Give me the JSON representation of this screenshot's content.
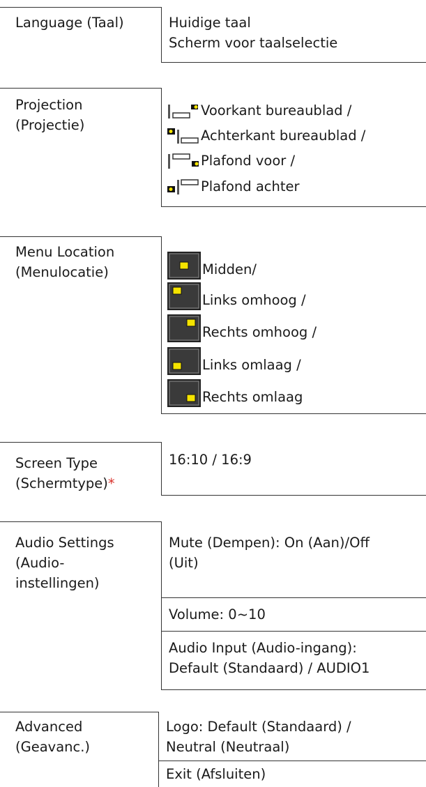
{
  "sections": [
    {
      "label_lines": [
        "Language (Taal)"
      ],
      "values": [
        [
          "Huidige taal",
          "Scherm voor taalselectie"
        ]
      ]
    },
    {
      "label_lines": [
        "Projection",
        "(Projectie)"
      ],
      "icon_items": [
        {
          "icon": "desk-front-projection-icon",
          "text": "Voorkant bureaublad /"
        },
        {
          "icon": "desk-rear-projection-icon",
          "text": "Achterkant bureaublad /"
        },
        {
          "icon": "ceiling-front-projection-icon",
          "text": "Plafond voor /"
        },
        {
          "icon": "ceiling-rear-projection-icon",
          "text": "Plafond achter"
        }
      ]
    },
    {
      "label_lines": [
        "Menu Location",
        "(Menulocatie)"
      ],
      "icon_items": [
        {
          "icon": "menu-center-icon",
          "text": "Midden/"
        },
        {
          "icon": "menu-top-left-icon",
          "text": "Links omhoog /"
        },
        {
          "icon": "menu-top-right-icon",
          "text": "Rechts omhoog /"
        },
        {
          "icon": "menu-bottom-left-icon",
          "text": "Links omlaag /"
        },
        {
          "icon": "menu-bottom-right-icon",
          "text": "Rechts omlaag"
        }
      ]
    },
    {
      "label_lines": [
        "Screen Type",
        "(Schermtype)"
      ],
      "label_marker": "*",
      "values": [
        [
          "16:10 / 16:9"
        ]
      ]
    },
    {
      "label_lines": [
        "Audio Settings",
        "(Audio-",
        "instellingen)"
      ],
      "values": [
        [
          "Mute (Dempen): On (Aan)/Off",
          "(Uit)"
        ],
        [
          "Volume: 0~10"
        ],
        [
          "Audio Input (Audio-ingang):",
          "Default (Standaard) / AUDIO1"
        ]
      ]
    },
    {
      "label_lines": [
        "Advanced",
        "(Geavanc.)"
      ],
      "values": [
        [
          "Logo: Default (Standaard) /",
          "Neutral (Neutraal)"
        ],
        [
          "Exit (Afsluiten)"
        ]
      ]
    }
  ],
  "colors": {
    "text": "#1a1a1a",
    "rule": "#333333",
    "required_marker": "#d9312b",
    "icon_yellow": "#f5e400",
    "icon_dark": "#3a3a3a"
  }
}
